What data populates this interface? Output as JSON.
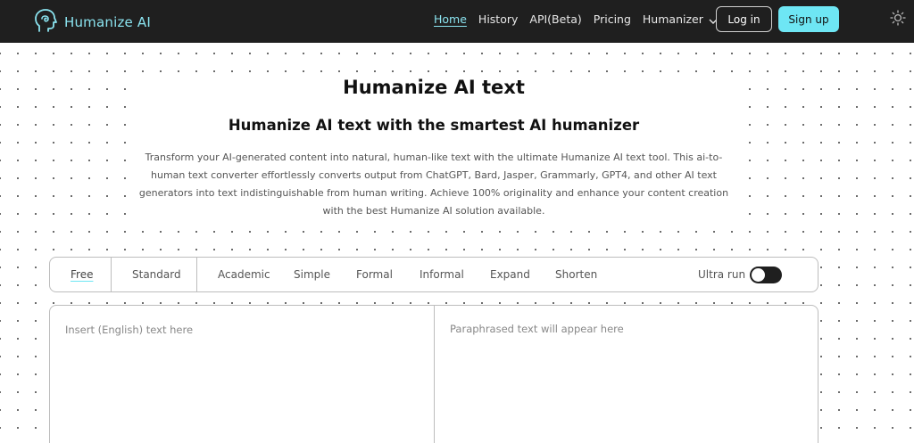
{
  "nav": {
    "brand": "Humanize AI",
    "links": [
      {
        "label": "Home",
        "active": true
      },
      {
        "label": "History"
      },
      {
        "label": "API(Beta)"
      },
      {
        "label": "Pricing"
      },
      {
        "label": "Humanizer",
        "dropdown": true
      }
    ],
    "login_label": "Log in",
    "signup_label": "Sign up",
    "theme_icon": "sun-icon"
  },
  "hero": {
    "title": "Humanize AI text",
    "subtitle": "Humanize AI text with the smartest AI humanizer",
    "description_lines": [
      "Transform your AI-generated content into natural, human-like text with the ultimate Humanize AI text tool. This ai-to-",
      "human text converter effortlessly converts output from ChatGPT, Bard, Jasper, Grammarly, GPT4, and other AI text",
      "generators into text indistinguishable from human writing. Achieve 100% originality and enhance your content creation",
      "with the best Humanize AI solution available."
    ]
  },
  "modes": {
    "items": [
      "Free",
      "Standard",
      "Academic",
      "Simple",
      "Formal",
      "Informal",
      "Expand",
      "Shorten"
    ],
    "active": "Free",
    "ultra_label": "Ultra run",
    "ultra_on": false
  },
  "editor": {
    "input_placeholder": "Insert (English) text here",
    "output_placeholder": "Paraphrased text will appear here"
  },
  "colors": {
    "accent": "#6ee6f4",
    "navbar": "#1f1f1f"
  }
}
